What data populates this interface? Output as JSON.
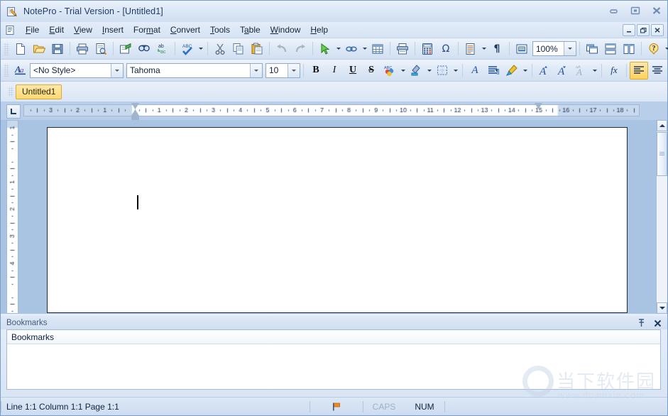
{
  "window": {
    "title": "NotePro - Trial Version - [Untitled1]",
    "app_icon": "notepad-pencil-icon",
    "controls": {
      "minimize": "–",
      "restore": "❐",
      "close": "✕"
    }
  },
  "mdi_controls": {
    "minimize": "_",
    "restore": "❐",
    "close": "✕"
  },
  "menu": {
    "doc_icon": "document-icon",
    "items": [
      {
        "label": "File",
        "accel": "F"
      },
      {
        "label": "Edit",
        "accel": "E"
      },
      {
        "label": "View",
        "accel": "V"
      },
      {
        "label": "Insert",
        "accel": "I"
      },
      {
        "label": "Format",
        "accel": "m"
      },
      {
        "label": "Convert",
        "accel": "C"
      },
      {
        "label": "Tools",
        "accel": "T"
      },
      {
        "label": "Table",
        "accel": "a"
      },
      {
        "label": "Window",
        "accel": "W"
      },
      {
        "label": "Help",
        "accel": "H"
      }
    ]
  },
  "standard_toolbar": {
    "items": [
      {
        "name": "new-icon",
        "kind": "button"
      },
      {
        "name": "open-icon",
        "kind": "button"
      },
      {
        "name": "save-icon",
        "kind": "button"
      },
      {
        "name": "separator",
        "kind": "sep"
      },
      {
        "name": "print-icon",
        "kind": "button"
      },
      {
        "name": "print-preview-icon",
        "kind": "button"
      },
      {
        "name": "separator",
        "kind": "sep"
      },
      {
        "name": "page-setup-icon",
        "kind": "button"
      },
      {
        "name": "find-icon",
        "kind": "button"
      },
      {
        "name": "replace-icon",
        "kind": "button"
      },
      {
        "name": "separator",
        "kind": "sep"
      },
      {
        "name": "spellcheck-icon",
        "kind": "button"
      },
      {
        "name": "spellcheck-dropdown",
        "kind": "arrow"
      },
      {
        "name": "separator",
        "kind": "sep"
      },
      {
        "name": "cut-icon",
        "kind": "button"
      },
      {
        "name": "copy-icon",
        "kind": "button"
      },
      {
        "name": "paste-icon",
        "kind": "button"
      },
      {
        "name": "separator",
        "kind": "sep"
      },
      {
        "name": "undo-icon",
        "kind": "button"
      },
      {
        "name": "redo-icon",
        "kind": "button"
      },
      {
        "name": "separator",
        "kind": "sep"
      },
      {
        "name": "cursor-select-icon",
        "kind": "button"
      },
      {
        "name": "cursor-dropdown",
        "kind": "arrow"
      },
      {
        "name": "hyperlink-icon",
        "kind": "button"
      },
      {
        "name": "hyperlink-dropdown",
        "kind": "arrow"
      },
      {
        "name": "insert-table-icon",
        "kind": "button"
      },
      {
        "name": "separator",
        "kind": "sep"
      },
      {
        "name": "print-merge-icon",
        "kind": "button"
      },
      {
        "name": "separator",
        "kind": "sep"
      },
      {
        "name": "calculator-icon",
        "kind": "button"
      },
      {
        "name": "symbol-omega-icon",
        "kind": "button"
      },
      {
        "name": "separator",
        "kind": "sep"
      },
      {
        "name": "document-props-icon",
        "kind": "button"
      },
      {
        "name": "document-dropdown",
        "kind": "arrow"
      },
      {
        "name": "pilcrow-icon",
        "kind": "button"
      },
      {
        "name": "separator",
        "kind": "sep"
      },
      {
        "name": "zoom-icon",
        "kind": "button"
      }
    ],
    "zoom_value": "100%",
    "right_items": [
      {
        "name": "cascade-windows-icon",
        "kind": "button"
      },
      {
        "name": "tile-horizontal-icon",
        "kind": "button"
      },
      {
        "name": "tile-vertical-icon",
        "kind": "button"
      },
      {
        "name": "separator",
        "kind": "sep"
      },
      {
        "name": "help-icon",
        "kind": "button"
      },
      {
        "name": "toolbar-overflow",
        "kind": "arrow"
      }
    ]
  },
  "format_toolbar": {
    "style_icon": "style-icon",
    "style_value": "<No Style>",
    "font_value": "Tahoma",
    "size_value": "10",
    "items": [
      {
        "name": "bold-button",
        "glyph": "B",
        "cls": "fbold",
        "on": false
      },
      {
        "name": "italic-button",
        "glyph": "I",
        "cls": "fital",
        "on": false
      },
      {
        "name": "underline-button",
        "glyph": "U",
        "cls": "fund",
        "on": false
      },
      {
        "name": "strikethrough-button",
        "glyph": "S",
        "cls": "fstrike",
        "on": false
      }
    ],
    "color_items": [
      {
        "name": "font-color-icon",
        "kind": "button"
      },
      {
        "name": "font-color-dropdown",
        "kind": "arrow"
      },
      {
        "name": "highlight-color-icon",
        "kind": "button"
      },
      {
        "name": "highlight-dropdown",
        "kind": "arrow"
      },
      {
        "name": "borders-icon",
        "kind": "button"
      },
      {
        "name": "borders-dropdown",
        "kind": "arrow"
      }
    ],
    "font_items": [
      {
        "name": "font-dialog-icon",
        "kind": "button"
      },
      {
        "name": "paragraph-dialog-icon",
        "kind": "button"
      },
      {
        "name": "format-painter-icon",
        "kind": "button"
      },
      {
        "name": "format-painter-dropdown",
        "kind": "arrow"
      }
    ],
    "case_items": [
      {
        "name": "grow-font-icon",
        "kind": "button"
      },
      {
        "name": "shrink-font-icon",
        "kind": "button"
      },
      {
        "name": "change-case-icon",
        "kind": "button"
      },
      {
        "name": "change-case-dropdown",
        "kind": "arrow"
      }
    ],
    "field_icon": "insert-field-icon",
    "align_items": [
      {
        "name": "align-left-button",
        "on": true
      },
      {
        "name": "align-center-button",
        "on": false
      },
      {
        "name": "align-right-button",
        "on": false
      }
    ],
    "overflow": "toolbar-overflow"
  },
  "tabs": {
    "active": "Untitled1"
  },
  "ruler": {
    "corner_icon": "tab-stop-icon",
    "left_labels": [
      "3",
      "2",
      "1"
    ],
    "right_labels": [
      "1",
      "2",
      "3",
      "4",
      "5",
      "6",
      "7",
      "8",
      "9",
      "10",
      "11",
      "12",
      "13",
      "14",
      "15",
      "16",
      "17",
      "18"
    ],
    "vertical_labels": [
      "2",
      "1",
      "1",
      "2",
      "3",
      "4"
    ],
    "unit": "inches"
  },
  "document": {
    "caret_visible": true
  },
  "scrollbar": {
    "up_arrow": "scroll-up-arrow",
    "down_arrow": "scroll-down-arrow"
  },
  "bookmarks_panel": {
    "title": "Bookmarks",
    "column_header": "Bookmarks",
    "pin_icon": "pin-icon",
    "close_icon": "close-icon",
    "rows": []
  },
  "status_bar": {
    "position": "Line 1:1 Column 1:1 Page 1:1",
    "flag_icon": "flag-icon",
    "caps": "CAPS",
    "num": "NUM"
  },
  "watermark": {
    "cn": "当下软件园",
    "url": "www.downxia.com"
  },
  "colors": {
    "titlebar": "#dde8f6",
    "toolbar": "#dde8f6",
    "accent_tab": "#ffd873",
    "editor_bg": "#a9c3e2",
    "page": "#ffffff",
    "text": "#10243e"
  }
}
